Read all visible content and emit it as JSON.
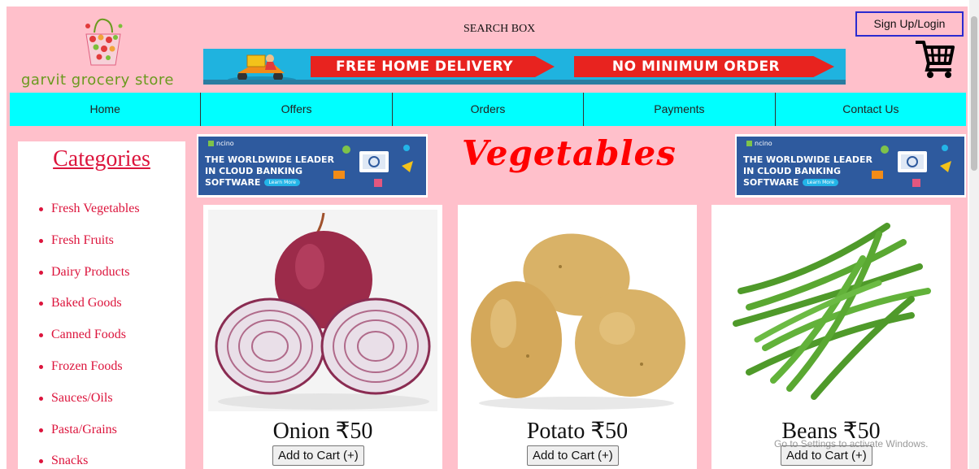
{
  "header": {
    "logo_text": "garvit grocery store",
    "search_label": "SEARCH BOX",
    "sign_in_label": "Sign Up/Login",
    "cart_icon": "shopping-cart-icon"
  },
  "delivery_banner": {
    "text1": "FREE HOME DELIVERY",
    "text2": "NO MINIMUM ORDER"
  },
  "nav": {
    "items": [
      {
        "label": "Home"
      },
      {
        "label": "Offers"
      },
      {
        "label": "Orders"
      },
      {
        "label": "Payments"
      },
      {
        "label": "Contact Us"
      }
    ]
  },
  "sidebar": {
    "title": "Categories",
    "items": [
      {
        "label": "Fresh Vegetables"
      },
      {
        "label": "Fresh Fruits"
      },
      {
        "label": "Dairy Products"
      },
      {
        "label": "Baked Goods"
      },
      {
        "label": "Canned Foods"
      },
      {
        "label": "Frozen Foods"
      },
      {
        "label": "Sauces/Oils"
      },
      {
        "label": "Pasta/Grains"
      },
      {
        "label": "Snacks"
      }
    ]
  },
  "ads": {
    "brand": "ncino",
    "line1": "THE WORLDWIDE LEADER",
    "line2": "IN CLOUD BANKING",
    "line3": "SOFTWARE",
    "cta": "Learn More"
  },
  "main": {
    "title": "Vegetables",
    "products": [
      {
        "name": "Onion ₹50",
        "button": "Add to Cart (+)"
      },
      {
        "name": "Potato ₹50",
        "button": "Add to Cart (+)"
      },
      {
        "name": "Beans ₹50",
        "button": "Add to Cart (+)"
      }
    ]
  },
  "watermark": "Go to Settings to activate Windows.",
  "colors": {
    "page_bg": "#ffc0cb",
    "nav_bg": "#00ffff",
    "accent_red": "#dc143c",
    "title_red": "#ff0000"
  }
}
